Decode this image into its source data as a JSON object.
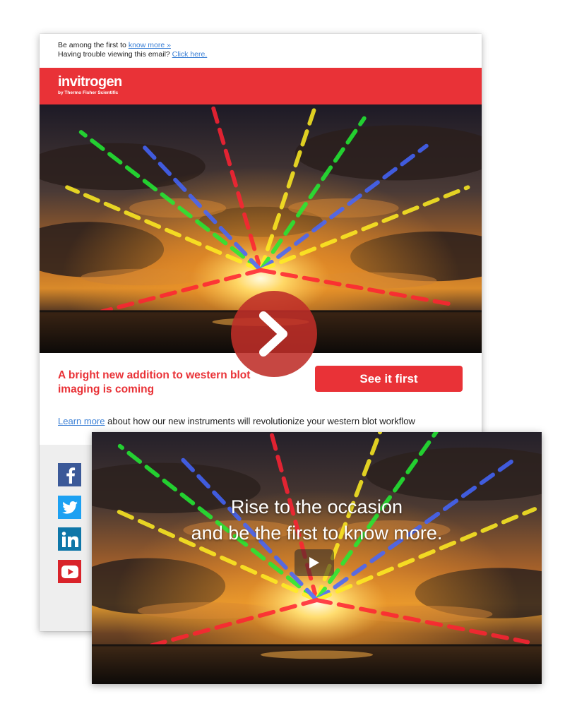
{
  "email": {
    "preheader": {
      "line1_text": "Be among the first to",
      "line1_link": "know more »",
      "line2_text": "Having trouble viewing this email?",
      "line2_link": "Click here."
    },
    "brand": {
      "name": "invitrogen",
      "tagline": "by Thermo Fisher Scientific",
      "color": "#e93237"
    },
    "headline": "A bright new addition to western blot imaging is coming",
    "cta_label": "See it first",
    "learn_more": {
      "link": "Learn more",
      "text": "about how our new instruments will revolutionize your western blot workflow"
    },
    "social": [
      {
        "name": "facebook",
        "icon": "facebook-icon",
        "color": "#3b5998"
      },
      {
        "name": "twitter",
        "icon": "twitter-icon",
        "color": "#1da1f2"
      },
      {
        "name": "linkedin",
        "icon": "linkedin-icon",
        "color": "#0e76a8"
      },
      {
        "name": "youtube",
        "icon": "youtube-icon",
        "color": "#d9232a"
      }
    ]
  },
  "overlay_play": {
    "icon": "play-chevron-icon",
    "color": "#be2d28"
  },
  "video": {
    "caption_line1": "Rise to the occasion",
    "caption_line2": "and be the first to know more.",
    "play_icon": "play-icon"
  }
}
